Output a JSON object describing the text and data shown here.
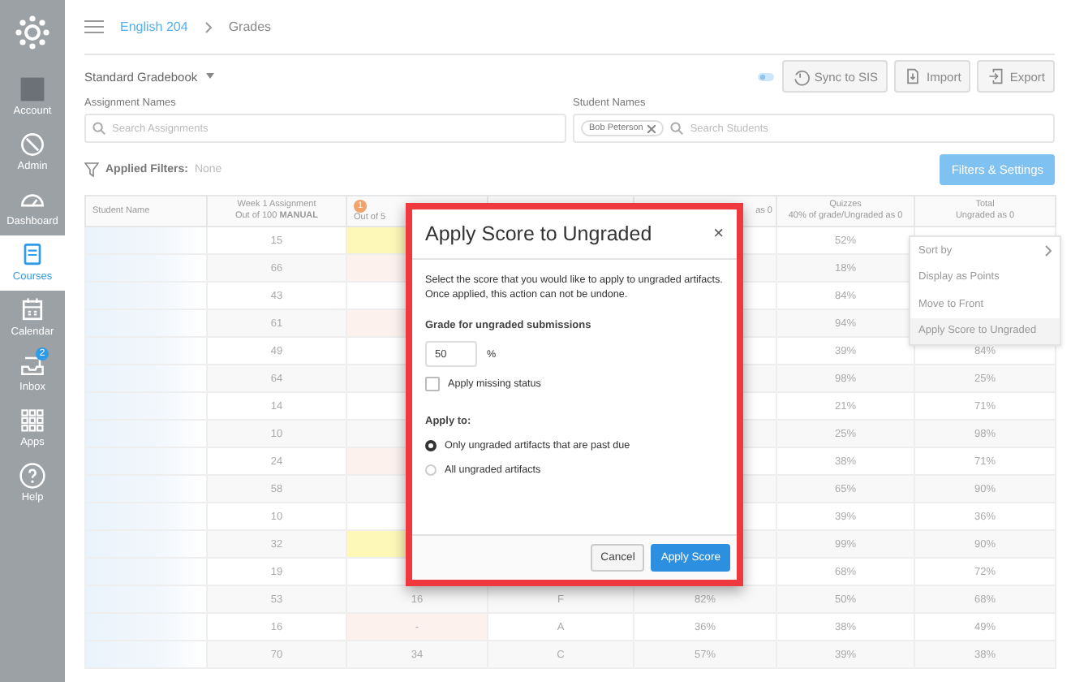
{
  "sidebar": {
    "items": [
      {
        "label": "Account",
        "selected": false
      },
      {
        "label": "Admin",
        "selected": false
      },
      {
        "label": "Dashboard",
        "selected": false
      },
      {
        "label": "Courses",
        "selected": true
      },
      {
        "label": "Calendar",
        "selected": false
      },
      {
        "label": "Inbox",
        "selected": false,
        "badge": "2"
      },
      {
        "label": "Apps",
        "selected": false
      },
      {
        "label": "Help",
        "selected": false
      }
    ]
  },
  "breadcrumb": [
    {
      "label": "English 204",
      "kind": "link"
    },
    {
      "label": "Grades",
      "kind": "current"
    }
  ],
  "gradebook_menu": {
    "label": "Standard Gradebook"
  },
  "actions": [
    {
      "label": "Sync to SIS"
    },
    {
      "label": "Import"
    },
    {
      "label": "Export"
    }
  ],
  "filters": {
    "assignment": {
      "label": "Assignment Names",
      "placeholder": "Search Assignments"
    },
    "student": {
      "label": "Student Names",
      "chips": [
        "Bob Peterson"
      ],
      "placeholder": "Search Students"
    },
    "applied_label": "Applied Filters:",
    "applied_value": "None",
    "settings_button": "Filters & Settings"
  },
  "table": {
    "columns": [
      {
        "title": "Student Name"
      },
      {
        "title": "Week 1 Assignment",
        "subtitle": "Out of 100 **MANUAL**"
      },
      {
        "badge": "1",
        "subtitle": "Out of 5"
      },
      {},
      {
        "subtitle": "as 0"
      },
      {
        "title": "Quizzes",
        "subtitle": "40% of grade/Ungraded as 0"
      },
      {
        "title": "Total",
        "subtitle": "Ungraded as 0"
      }
    ],
    "rows": [
      {
        "kind": "pending",
        "week_1": "15",
        "quizzes": "52%"
      },
      {
        "kind": "flagged",
        "week_1": "66",
        "quizzes": "18%"
      },
      {
        "kind": "plain",
        "week_1": "43",
        "quizzes": "84%"
      },
      {
        "kind": "flagged",
        "week_1": "61",
        "quizzes": "94%"
      },
      {
        "kind": "plain",
        "week_1": "49",
        "quizzes": "39%",
        "total": "84%"
      },
      {
        "kind": "plain",
        "week_1": "64",
        "quizzes": "98%",
        "total": "25%"
      },
      {
        "kind": "plain",
        "week_1": "14",
        "quizzes": "21%",
        "total": "71%"
      },
      {
        "kind": "plain",
        "week_1": "10",
        "quizzes": "25%",
        "total": "98%"
      },
      {
        "kind": "flagged",
        "week_1": "24",
        "quizzes": "38%",
        "total": "71%"
      },
      {
        "kind": "plain",
        "week_1": "58",
        "quizzes": "65%",
        "total": "90%"
      },
      {
        "kind": "plain",
        "week_1": "10",
        "quizzes": "39%",
        "total": "36%"
      },
      {
        "kind": "pending",
        "week_1": "32",
        "quizzes": "99%",
        "total": "90%"
      },
      {
        "kind": "plain",
        "week_1": "19",
        "quizzes": "68%",
        "total": "72%"
      },
      {
        "kind": "plain",
        "week_1": "53",
        "column_2": "16",
        "column_3": "F",
        "column_4": "82%",
        "quizzes": "50%",
        "total": "68%"
      },
      {
        "kind": "flagged",
        "week_1": "16",
        "column_2": "-",
        "column_3": "A",
        "column_4": "36%",
        "quizzes": "38%",
        "total": "49%"
      },
      {
        "kind": "plain",
        "week_1": "70",
        "column_2": "34",
        "column_3": "C",
        "column_4": "57%",
        "quizzes": "39%",
        "total": "38%"
      }
    ]
  },
  "column_menu": {
    "items": [
      {
        "label": "Sort by",
        "submenu": true,
        "selected": false
      },
      {
        "label": "Display as Points",
        "submenu": false,
        "selected": false
      },
      {
        "label": "Move to Front",
        "submenu": false,
        "selected": false
      },
      {
        "label": "Apply Score to Ungraded",
        "submenu": false,
        "selected": true
      }
    ]
  },
  "dialog": {
    "title": "Apply Score to Ungraded",
    "close": "×",
    "message": "Select the score that you would like to apply to ungraded artifacts.  Once applied, this action can not be undone.",
    "grade_label": "Grade for ungraded submissions",
    "grade_value": "50",
    "grade_unit": "%",
    "missing_status": {
      "label": "Apply missing status",
      "checked": false
    },
    "apply_to_label": "Apply to:",
    "apply_to_options": [
      {
        "label": "Only ungraded artifacts that are past due",
        "selected": true
      },
      {
        "label": "All ungraded artifacts",
        "selected": false
      }
    ],
    "buttons": [
      {
        "label": "Cancel",
        "kind": "secondary"
      },
      {
        "label": "Apply Score",
        "kind": "primary"
      }
    ]
  }
}
